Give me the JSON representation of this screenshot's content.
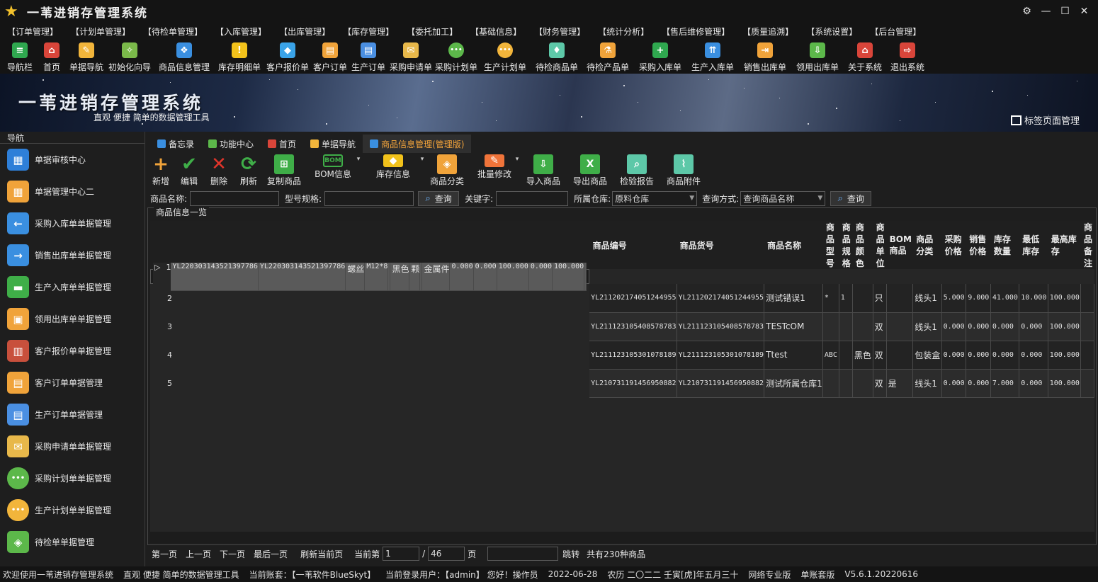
{
  "window": {
    "title": "一苇进销存管理系统"
  },
  "menu": [
    "【订单管理】",
    "【计划单管理】",
    "【待检单管理】",
    "【入库管理】",
    "【出库管理】",
    "【库存管理】",
    "【委托加工】",
    "【基础信息】",
    "【财务管理】",
    "【统计分析】",
    "【售后维修管理】",
    "【质量追溯】",
    "【系统设置】",
    "【后台管理】"
  ],
  "toolbar": [
    {
      "label": "导航栏",
      "icon": "menu-lines-icon",
      "color": "#2fa84f",
      "glyph": "≡"
    },
    {
      "label": "首页",
      "icon": "home-icon",
      "color": "#d9453a",
      "glyph": "⌂"
    },
    {
      "label": "单据导航",
      "icon": "nav-pen-icon",
      "color": "#f2b53b",
      "glyph": "✎"
    },
    {
      "label": "初始化向导",
      "icon": "magic-wand-icon",
      "color": "#7bb94a",
      "glyph": "✧"
    },
    {
      "label": "商品信息管理",
      "icon": "cubes-icon",
      "color": "#3a8fe0",
      "glyph": "❖"
    },
    {
      "label": "库存明细单",
      "icon": "warning-icon",
      "color": "#f2c21b",
      "glyph": "!"
    },
    {
      "label": "客户报价单",
      "icon": "price-tag-icon",
      "color": "#3aa3e8",
      "glyph": "◆"
    },
    {
      "label": "客户订单",
      "icon": "order-doc-icon",
      "color": "#f0a33a",
      "glyph": "▤"
    },
    {
      "label": "生产订单",
      "icon": "production-doc-icon",
      "color": "#4a8fe2",
      "glyph": "▤"
    },
    {
      "label": "采购申请单",
      "icon": "purchase-request-icon",
      "color": "#e8b84a",
      "glyph": "✉"
    },
    {
      "label": "采购计划单",
      "icon": "purchase-plan-icon",
      "color": "#5cb84a",
      "glyph": "•••"
    },
    {
      "label": "生产计划单",
      "icon": "production-plan-icon",
      "color": "#f2b53b",
      "glyph": "•••"
    },
    {
      "label": "待检商品单",
      "icon": "inspect-goods-icon",
      "color": "#5dc8a8",
      "glyph": "♦"
    },
    {
      "label": "待检产品单",
      "icon": "flask-icon",
      "color": "#f0a33a",
      "glyph": "⚗"
    },
    {
      "label": "采购入库单",
      "icon": "plus-circle-icon",
      "color": "#2fa84f",
      "glyph": "+"
    },
    {
      "label": "生产入库单",
      "icon": "hand-truck-icon",
      "color": "#3a8fe0",
      "glyph": "⇈"
    },
    {
      "label": "销售出库单",
      "icon": "sales-out-icon",
      "color": "#f0a33a",
      "glyph": "⇥"
    },
    {
      "label": "领用出库单",
      "icon": "download-box-icon",
      "color": "#5cb84a",
      "glyph": "⇩"
    },
    {
      "label": "关于系统",
      "icon": "about-home-icon",
      "color": "#d9453a",
      "glyph": "⌂"
    },
    {
      "label": "退出系统",
      "icon": "exit-icon",
      "color": "#d9453a",
      "glyph": "⇨"
    }
  ],
  "banner": {
    "title": "一苇进销存管理系统",
    "subtitle": "直观 便捷 简单的数据管理工具",
    "tag_label": "标签页面管理"
  },
  "sidebar": {
    "header": "导航",
    "items": [
      {
        "label": "单据审核中心",
        "icon": "audit-grid-icon",
        "color": "#2e7fd8",
        "glyph": "▦"
      },
      {
        "label": "单据管理中心二",
        "icon": "manage-grid-icon",
        "color": "#f0a33a",
        "glyph": "▦"
      },
      {
        "label": "采购入库单单据管理",
        "icon": "arrow-left-icon",
        "color": "#3a8fe0",
        "glyph": "←"
      },
      {
        "label": "销售出库单单据管理",
        "icon": "arrow-right-icon",
        "color": "#3a8fe0",
        "glyph": "→"
      },
      {
        "label": "生产入库单单据管理",
        "icon": "folder-green-icon",
        "color": "#3fae48",
        "glyph": "▬"
      },
      {
        "label": "领用出库单单据管理",
        "icon": "box-orange-icon",
        "color": "#f0a33a",
        "glyph": "▣"
      },
      {
        "label": "客户报价单单据管理",
        "icon": "books-icon",
        "color": "#c8503c",
        "glyph": "▥"
      },
      {
        "label": "客户订单单据管理",
        "icon": "order-doc-icon",
        "color": "#f0a33a",
        "glyph": "▤"
      },
      {
        "label": "生产订单单据管理",
        "icon": "production-doc-icon",
        "color": "#4a8fe2",
        "glyph": "▤"
      },
      {
        "label": "采购申请单单据管理",
        "icon": "envelope-icon",
        "color": "#e8b84a",
        "glyph": "✉"
      },
      {
        "label": "采购计划单单据管理",
        "icon": "chat-green-icon",
        "color": "#5cb84a",
        "glyph": "•••"
      },
      {
        "label": "生产计划单单据管理",
        "icon": "chat-yellow-icon",
        "color": "#f2b53b",
        "glyph": "•••"
      },
      {
        "label": "待检单单据管理",
        "icon": "check-doc-icon",
        "color": "#5cb84a",
        "glyph": "◈"
      }
    ]
  },
  "tabs": [
    {
      "label": "备忘录",
      "icon": "memo-icon",
      "color": "#3a8fe0",
      "active": false
    },
    {
      "label": "功能中心",
      "icon": "function-center-icon",
      "color": "#5cb84a",
      "active": false
    },
    {
      "label": "首页",
      "icon": "home-icon",
      "color": "#d9453a",
      "active": false
    },
    {
      "label": "单据导航",
      "icon": "nav-pen-icon",
      "color": "#f2b53b",
      "active": false
    },
    {
      "label": "商品信息管理(管理版)",
      "icon": "cubes-icon",
      "color": "#3a8fe0",
      "active": true
    }
  ],
  "grid_toolbar": [
    {
      "label": "新增",
      "icon": "add-icon",
      "color": "#f0a33a",
      "glyph": "+",
      "dd": false
    },
    {
      "label": "编辑",
      "icon": "check-icon",
      "color": "#3fae48",
      "glyph": "✔",
      "dd": false
    },
    {
      "label": "删除",
      "icon": "delete-x-icon",
      "color": "#e0352b",
      "glyph": "✕",
      "dd": false
    },
    {
      "label": "刷新",
      "icon": "refresh-icon",
      "color": "#3fae48",
      "glyph": "⟳",
      "dd": false
    },
    {
      "label": "复制商品",
      "icon": "copy-icon",
      "color": "#3fae48",
      "glyph": "⊞",
      "dd": false
    },
    {
      "label": "BOM信息",
      "icon": "bom-icon",
      "color": "#3fae48",
      "glyph": "BOM",
      "dd": true
    },
    {
      "label": "库存信息",
      "icon": "stock-box-icon",
      "color": "#f2c21b",
      "glyph": "◆",
      "dd": true
    },
    {
      "label": "商品分类",
      "icon": "category-tags-icon",
      "color": "#f0a33a",
      "glyph": "◈",
      "dd": false
    },
    {
      "label": "批量修改",
      "icon": "batch-edit-icon",
      "color": "#f0743a",
      "glyph": "✎",
      "dd": true
    },
    {
      "label": "导入商品",
      "icon": "import-folder-icon",
      "color": "#3fae48",
      "glyph": "⇩",
      "dd": false
    },
    {
      "label": "导出商品",
      "icon": "excel-export-icon",
      "color": "#3fae48",
      "glyph": "X",
      "dd": false
    },
    {
      "label": "检验报告",
      "icon": "inspection-report-icon",
      "color": "#5dc8a8",
      "glyph": "⌕",
      "dd": false
    },
    {
      "label": "商品附件",
      "icon": "paperclip-icon",
      "color": "#5dc8a8",
      "glyph": "⌇",
      "dd": false
    }
  ],
  "filter": {
    "name_label": "商品名称:",
    "name_value": "",
    "spec_label": "型号规格:",
    "spec_value": "",
    "query_btn": "查询",
    "keyword_label": "关键字:",
    "keyword_value": "",
    "warehouse_label": "所属仓库:",
    "warehouse_value": "原料仓库",
    "method_label": "查询方式:",
    "method_value": "查询商品名称",
    "query_btn2": "查询"
  },
  "list": {
    "title": "商品信息一览",
    "columns": [
      "商品编号",
      "商品货号",
      "商品名称",
      "商品型号",
      "商品规格",
      "商品颜色",
      "商品单位",
      "BOM商品",
      "商品分类",
      "采购价格",
      "销售价格",
      "库存数量",
      "最低库存",
      "最高库存",
      "商品备注"
    ],
    "rows": [
      {
        "idx": "1",
        "cells": [
          "YL220303143521397786",
          "YL220303143521397786",
          "螺丝",
          "M12*8",
          "",
          "黑色",
          "颗",
          "",
          "金属件",
          "0.000",
          "0.000",
          "100.000",
          "0.000",
          "100.000",
          ""
        ],
        "selected": true
      },
      {
        "idx": "2",
        "cells": [
          "YL211202174051244955",
          "YL211202174051244955",
          "测试错误1",
          "*",
          "1",
          "",
          "只",
          "",
          "线头1",
          "5.000",
          "9.000",
          "41.000",
          "10.000",
          "100.000",
          ""
        ],
        "selected": false
      },
      {
        "idx": "3",
        "cells": [
          "YL211123105408578783",
          "YL211123105408578783",
          "TESTcOM",
          "",
          "",
          "",
          "双",
          "",
          "线头1",
          "0.000",
          "0.000",
          "0.000",
          "0.000",
          "100.000",
          ""
        ],
        "selected": false
      },
      {
        "idx": "4",
        "cells": [
          "YL211123105301078189",
          "YL211123105301078189",
          "Ttest",
          "ABC",
          "",
          "黑色",
          "双",
          "",
          "包装盒",
          "0.000",
          "0.000",
          "0.000",
          "0.000",
          "100.000",
          ""
        ],
        "selected": false
      },
      {
        "idx": "5",
        "cells": [
          "YL210731191456950882",
          "YL210731191456950882",
          "测试所属仓库1",
          "",
          "",
          "",
          "双",
          "是",
          "线头1",
          "0.000",
          "0.000",
          "7.000",
          "0.000",
          "100.000",
          ""
        ],
        "selected": false
      }
    ]
  },
  "pager": {
    "first": "第一页",
    "prev": "上一页",
    "next": "下一页",
    "last": "最后一页",
    "refresh": "刷新当前页",
    "current_label": "当前第",
    "current": "1",
    "sep": "/",
    "total_pages": "46",
    "page_unit": "页",
    "jump_value": "",
    "jump": "跳转",
    "total": "共有230种商品"
  },
  "status": [
    "欢迎使用一苇进销存管理系统",
    "直观 便捷 简单的数据管理工具",
    "当前账套：【一苇软件BlueSkyt】",
    "当前登录用户：【admin】 您好！操作员",
    "2022-06-28",
    "农历 二〇二二 壬寅[虎]年五月三十",
    "网络专业版",
    "单账套版",
    "V5.6.1.20220616"
  ]
}
